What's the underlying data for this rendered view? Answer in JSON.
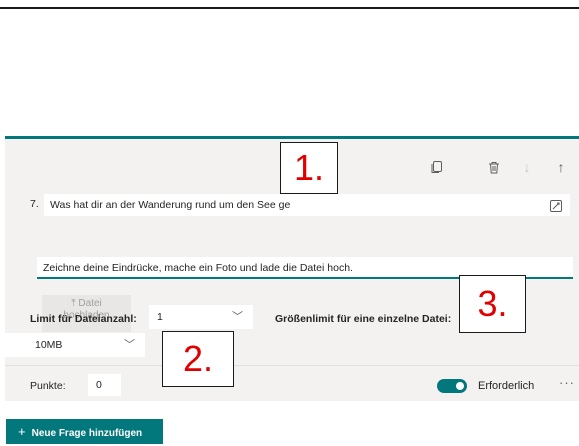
{
  "question": {
    "number": "7.",
    "title": "Was hat dir an der Wanderung rund um den See ge",
    "subtitle": "Zeichne deine Eindrücke, mache ein Foto und lade die Datei hoch."
  },
  "toolbar": {
    "copy_icon": "copy-icon",
    "delete_icon": "trash-icon",
    "down_icon": "arrow-down-icon",
    "up_icon": "arrow-up-icon"
  },
  "upload": {
    "label_line1": "Datei",
    "label_line2": "hochladen"
  },
  "file_limit": {
    "label": "Limit für Dateianzahl:",
    "value": "1"
  },
  "size_limit": {
    "label": "Größenlimit für eine einzelne Datei:",
    "value": "10MB"
  },
  "points": {
    "label": "Punkte:",
    "value": "0"
  },
  "required": {
    "label": "Erforderlich",
    "on": true
  },
  "add_question": {
    "label": "Neue Frage hinzufügen"
  },
  "callouts": {
    "one": "1.",
    "two": "2.",
    "three": "3."
  },
  "colors": {
    "accent": "#03787c",
    "callout": "#e00000"
  }
}
